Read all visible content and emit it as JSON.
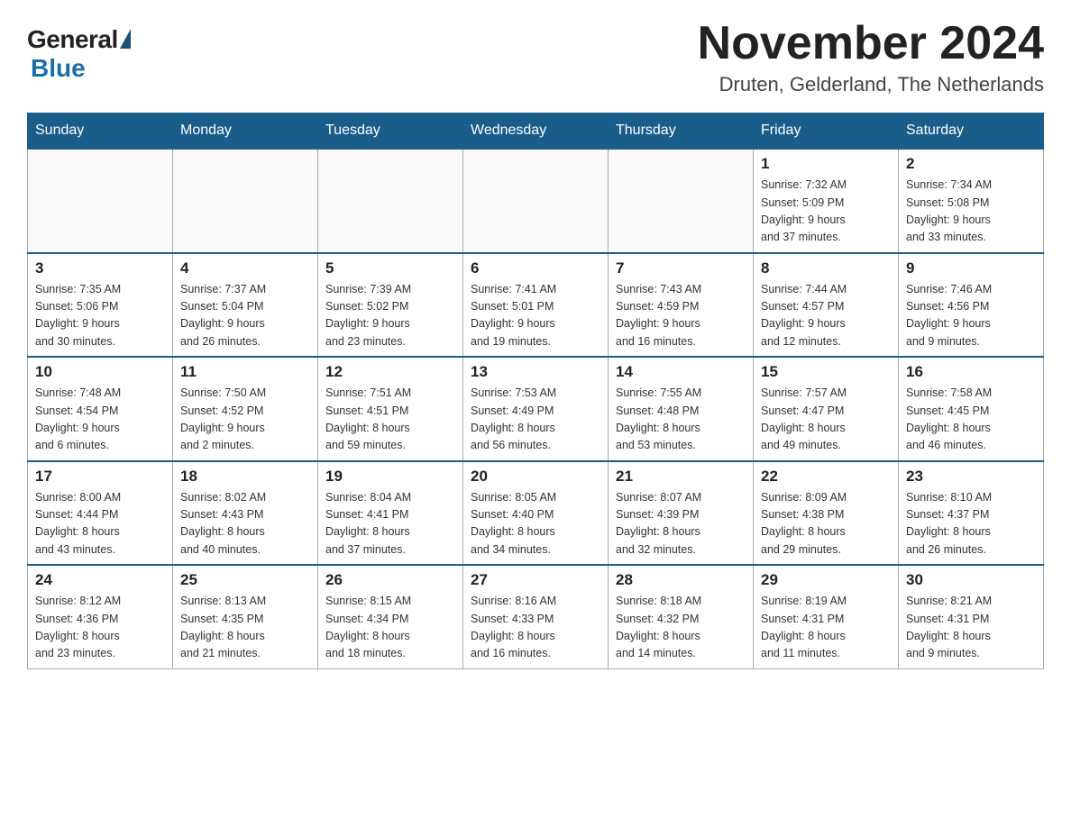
{
  "logo": {
    "general": "General",
    "blue": "Blue"
  },
  "title": "November 2024",
  "subtitle": "Druten, Gelderland, The Netherlands",
  "days_of_week": [
    "Sunday",
    "Monday",
    "Tuesday",
    "Wednesday",
    "Thursday",
    "Friday",
    "Saturday"
  ],
  "weeks": [
    [
      {
        "day": "",
        "info": ""
      },
      {
        "day": "",
        "info": ""
      },
      {
        "day": "",
        "info": ""
      },
      {
        "day": "",
        "info": ""
      },
      {
        "day": "",
        "info": ""
      },
      {
        "day": "1",
        "info": "Sunrise: 7:32 AM\nSunset: 5:09 PM\nDaylight: 9 hours\nand 37 minutes."
      },
      {
        "day": "2",
        "info": "Sunrise: 7:34 AM\nSunset: 5:08 PM\nDaylight: 9 hours\nand 33 minutes."
      }
    ],
    [
      {
        "day": "3",
        "info": "Sunrise: 7:35 AM\nSunset: 5:06 PM\nDaylight: 9 hours\nand 30 minutes."
      },
      {
        "day": "4",
        "info": "Sunrise: 7:37 AM\nSunset: 5:04 PM\nDaylight: 9 hours\nand 26 minutes."
      },
      {
        "day": "5",
        "info": "Sunrise: 7:39 AM\nSunset: 5:02 PM\nDaylight: 9 hours\nand 23 minutes."
      },
      {
        "day": "6",
        "info": "Sunrise: 7:41 AM\nSunset: 5:01 PM\nDaylight: 9 hours\nand 19 minutes."
      },
      {
        "day": "7",
        "info": "Sunrise: 7:43 AM\nSunset: 4:59 PM\nDaylight: 9 hours\nand 16 minutes."
      },
      {
        "day": "8",
        "info": "Sunrise: 7:44 AM\nSunset: 4:57 PM\nDaylight: 9 hours\nand 12 minutes."
      },
      {
        "day": "9",
        "info": "Sunrise: 7:46 AM\nSunset: 4:56 PM\nDaylight: 9 hours\nand 9 minutes."
      }
    ],
    [
      {
        "day": "10",
        "info": "Sunrise: 7:48 AM\nSunset: 4:54 PM\nDaylight: 9 hours\nand 6 minutes."
      },
      {
        "day": "11",
        "info": "Sunrise: 7:50 AM\nSunset: 4:52 PM\nDaylight: 9 hours\nand 2 minutes."
      },
      {
        "day": "12",
        "info": "Sunrise: 7:51 AM\nSunset: 4:51 PM\nDaylight: 8 hours\nand 59 minutes."
      },
      {
        "day": "13",
        "info": "Sunrise: 7:53 AM\nSunset: 4:49 PM\nDaylight: 8 hours\nand 56 minutes."
      },
      {
        "day": "14",
        "info": "Sunrise: 7:55 AM\nSunset: 4:48 PM\nDaylight: 8 hours\nand 53 minutes."
      },
      {
        "day": "15",
        "info": "Sunrise: 7:57 AM\nSunset: 4:47 PM\nDaylight: 8 hours\nand 49 minutes."
      },
      {
        "day": "16",
        "info": "Sunrise: 7:58 AM\nSunset: 4:45 PM\nDaylight: 8 hours\nand 46 minutes."
      }
    ],
    [
      {
        "day": "17",
        "info": "Sunrise: 8:00 AM\nSunset: 4:44 PM\nDaylight: 8 hours\nand 43 minutes."
      },
      {
        "day": "18",
        "info": "Sunrise: 8:02 AM\nSunset: 4:43 PM\nDaylight: 8 hours\nand 40 minutes."
      },
      {
        "day": "19",
        "info": "Sunrise: 8:04 AM\nSunset: 4:41 PM\nDaylight: 8 hours\nand 37 minutes."
      },
      {
        "day": "20",
        "info": "Sunrise: 8:05 AM\nSunset: 4:40 PM\nDaylight: 8 hours\nand 34 minutes."
      },
      {
        "day": "21",
        "info": "Sunrise: 8:07 AM\nSunset: 4:39 PM\nDaylight: 8 hours\nand 32 minutes."
      },
      {
        "day": "22",
        "info": "Sunrise: 8:09 AM\nSunset: 4:38 PM\nDaylight: 8 hours\nand 29 minutes."
      },
      {
        "day": "23",
        "info": "Sunrise: 8:10 AM\nSunset: 4:37 PM\nDaylight: 8 hours\nand 26 minutes."
      }
    ],
    [
      {
        "day": "24",
        "info": "Sunrise: 8:12 AM\nSunset: 4:36 PM\nDaylight: 8 hours\nand 23 minutes."
      },
      {
        "day": "25",
        "info": "Sunrise: 8:13 AM\nSunset: 4:35 PM\nDaylight: 8 hours\nand 21 minutes."
      },
      {
        "day": "26",
        "info": "Sunrise: 8:15 AM\nSunset: 4:34 PM\nDaylight: 8 hours\nand 18 minutes."
      },
      {
        "day": "27",
        "info": "Sunrise: 8:16 AM\nSunset: 4:33 PM\nDaylight: 8 hours\nand 16 minutes."
      },
      {
        "day": "28",
        "info": "Sunrise: 8:18 AM\nSunset: 4:32 PM\nDaylight: 8 hours\nand 14 minutes."
      },
      {
        "day": "29",
        "info": "Sunrise: 8:19 AM\nSunset: 4:31 PM\nDaylight: 8 hours\nand 11 minutes."
      },
      {
        "day": "30",
        "info": "Sunrise: 8:21 AM\nSunset: 4:31 PM\nDaylight: 8 hours\nand 9 minutes."
      }
    ]
  ]
}
